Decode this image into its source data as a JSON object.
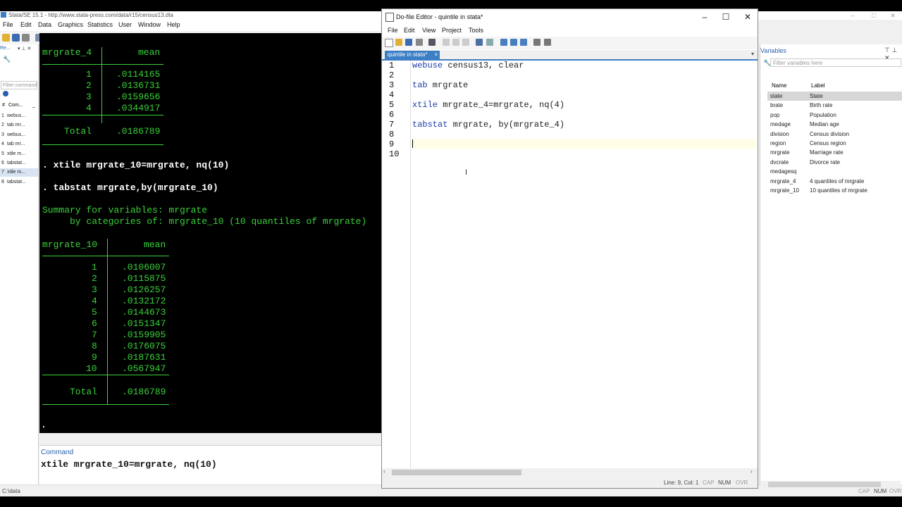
{
  "main_window": {
    "title": "Stata/SE 15.1 - http://www.stata-press.com/data/r15/census13.dta",
    "menu": [
      "File",
      "Edit",
      "Data",
      "Graphics",
      "Statistics",
      "User",
      "Window",
      "Help"
    ]
  },
  "review": {
    "header": "Re...",
    "filter_placeholder": "Filter command",
    "col_num": "#",
    "col_cmd": "Com...",
    "col_rc": "_",
    "items": [
      {
        "num": "1",
        "cmd": "webus..."
      },
      {
        "num": "2",
        "cmd": "tab mr..."
      },
      {
        "num": "3",
        "cmd": "webus..."
      },
      {
        "num": "4",
        "cmd": "tab mr..."
      },
      {
        "num": "5",
        "cmd": "xtile m..."
      },
      {
        "num": "6",
        "cmd": "tabstat..."
      },
      {
        "num": "7",
        "cmd": "xtile m..."
      },
      {
        "num": "8",
        "cmd": "tabstat..."
      }
    ]
  },
  "results": {
    "table1_header_var": "mrgrate_4",
    "table1_header_stat": "mean",
    "table1_rows": [
      {
        "cat": "1",
        "mean": ".0114165"
      },
      {
        "cat": "2",
        "mean": ".0136731"
      },
      {
        "cat": "3",
        "mean": ".0159656"
      },
      {
        "cat": "4",
        "mean": ".0344917"
      }
    ],
    "table1_total_label": "Total",
    "table1_total": ".0186789",
    "cmd1": ". xtile mrgrate_10=mrgrate, nq(10)",
    "cmd2": ". tabstat mrgrate,by(mrgrate_10)",
    "summary_line1": "Summary for variables: mrgrate",
    "summary_line2": "     by categories of: mrgrate_10 (10 quantiles of mrgrate)",
    "table2_header_var": "mrgrate_10",
    "table2_header_stat": "mean",
    "table2_rows": [
      {
        "cat": "1",
        "mean": ".0106007"
      },
      {
        "cat": "2",
        "mean": ".0115875"
      },
      {
        "cat": "3",
        "mean": ".0126257"
      },
      {
        "cat": "4",
        "mean": ".0132172"
      },
      {
        "cat": "5",
        "mean": ".0144673"
      },
      {
        "cat": "6",
        "mean": ".0151347"
      },
      {
        "cat": "7",
        "mean": ".0159905"
      },
      {
        "cat": "8",
        "mean": ".0176075"
      },
      {
        "cat": "9",
        "mean": ".0187631"
      },
      {
        "cat": "10",
        "mean": ".0567947"
      }
    ],
    "table2_total_label": "Total",
    "table2_total": ".0186789",
    "prompt": "."
  },
  "command_window": {
    "label": "Command",
    "text": "xtile mrgrate_10=mrgrate, nq(10)"
  },
  "status_bar": {
    "path": "C:\\data",
    "cap": "CAP",
    "num": "NUM",
    "ovr": "OVR"
  },
  "variables": {
    "header": "Variables",
    "filter_placeholder": "Filter variables here",
    "col_name": "Name",
    "col_label": "Label",
    "rows": [
      {
        "name": "state",
        "label": "State"
      },
      {
        "name": "brate",
        "label": "Birth rate"
      },
      {
        "name": "pop",
        "label": "Population"
      },
      {
        "name": "medage",
        "label": "Median age"
      },
      {
        "name": "division",
        "label": "Census division"
      },
      {
        "name": "region",
        "label": "Census region"
      },
      {
        "name": "mrgrate",
        "label": "Marriage rate"
      },
      {
        "name": "dvcrate",
        "label": "Divorce rate"
      },
      {
        "name": "medagesq",
        "label": ""
      },
      {
        "name": "mrgrate_4",
        "label": "4 quantiles of mrgrate"
      },
      {
        "name": "mrgrate_10",
        "label": "10 quantiles of mrgrate"
      }
    ]
  },
  "dofile": {
    "title": "Do-file Editor - quintile in stata*",
    "menu": [
      "File",
      "Edit",
      "View",
      "Project",
      "Tools"
    ],
    "tab_label": "quintile in stata*",
    "tab_close": "×",
    "line_numbers": [
      "1",
      "2",
      "3",
      "4",
      "5",
      "6",
      "7",
      "8",
      "9",
      "10"
    ],
    "lines": [
      {
        "kw": "webuse",
        "rest": " census13, clear"
      },
      {
        "kw": "",
        "rest": ""
      },
      {
        "kw": "tab",
        "rest": " mrgrate"
      },
      {
        "kw": "",
        "rest": ""
      },
      {
        "kw": "xtile",
        "rest": " mrgrate_4=mrgrate, nq(4)"
      },
      {
        "kw": "",
        "rest": ""
      },
      {
        "kw": "tabstat",
        "rest": " mrgrate, by(mrgrate_4)"
      },
      {
        "kw": "",
        "rest": ""
      },
      {
        "kw": "",
        "rest": ""
      },
      {
        "kw": "",
        "rest": ""
      }
    ],
    "status_position": "Line: 9, Col: 1",
    "status_cap": "CAP",
    "status_num": "NUM",
    "status_ovr": "OVR"
  },
  "colors": {
    "results_bg": "#000000",
    "results_text": "#3ad13a",
    "accent": "#3c7fc4",
    "keyword": "#1e3ea8"
  }
}
